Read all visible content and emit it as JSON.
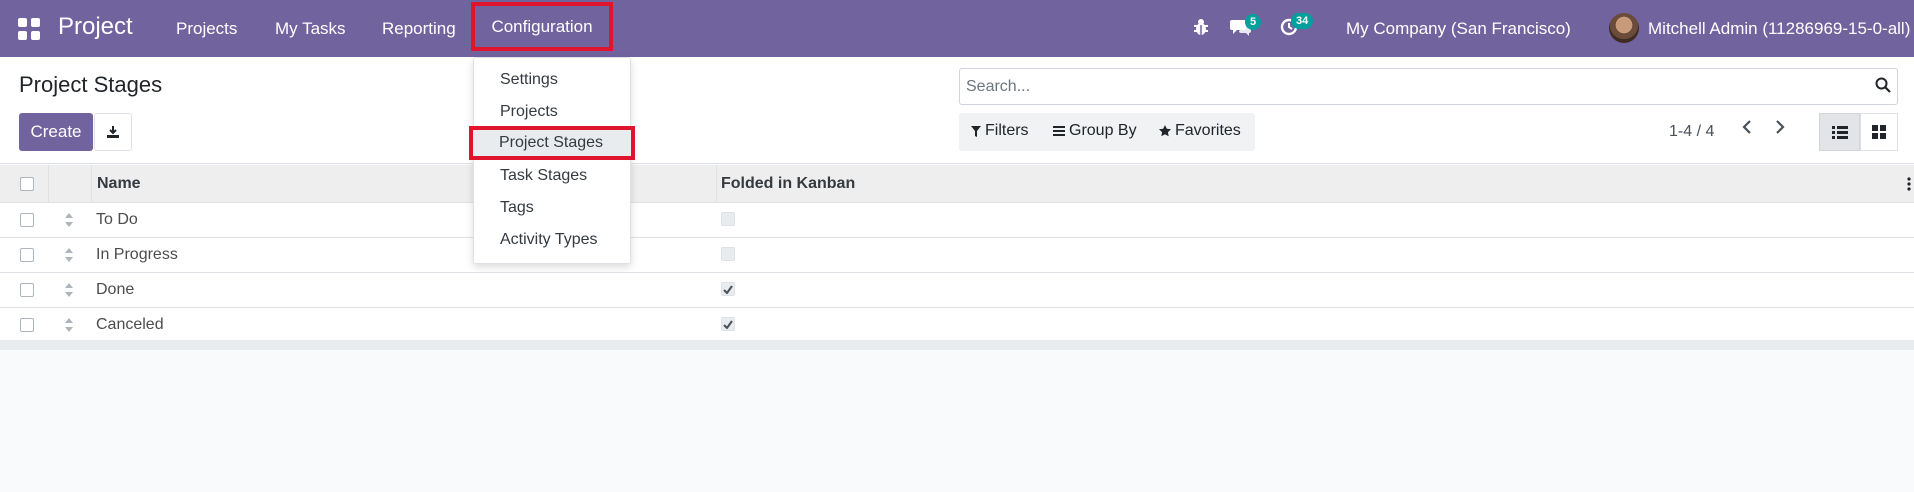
{
  "navbar": {
    "brand": "Project",
    "menu": [
      "Projects",
      "My Tasks",
      "Reporting",
      "Configuration"
    ],
    "messages_badge": "5",
    "activities_badge": "34",
    "company": "My Company (San Francisco)",
    "user": "Mitchell Admin (11286969-15-0-all)"
  },
  "control_panel": {
    "title": "Project Stages",
    "create_label": "Create",
    "search_placeholder": "Search...",
    "filters_label": "Filters",
    "group_by_label": "Group By",
    "favorites_label": "Favorites",
    "pager": "1-4 / 4"
  },
  "table": {
    "columns": [
      "Name",
      "Folded in Kanban"
    ],
    "rows": [
      {
        "name": "To Do",
        "folded": false
      },
      {
        "name": "In Progress",
        "folded": false
      },
      {
        "name": "Done",
        "folded": true
      },
      {
        "name": "Canceled",
        "folded": true
      }
    ]
  },
  "configuration_menu": {
    "items": [
      "Settings",
      "Projects",
      "Project Stages",
      "Task Stages",
      "Tags",
      "Activity Types"
    ],
    "selected": "Project Stages"
  },
  "colors": {
    "navbar": "#71639e",
    "highlight_border": "#e0142c",
    "badge": "#00a09d"
  }
}
